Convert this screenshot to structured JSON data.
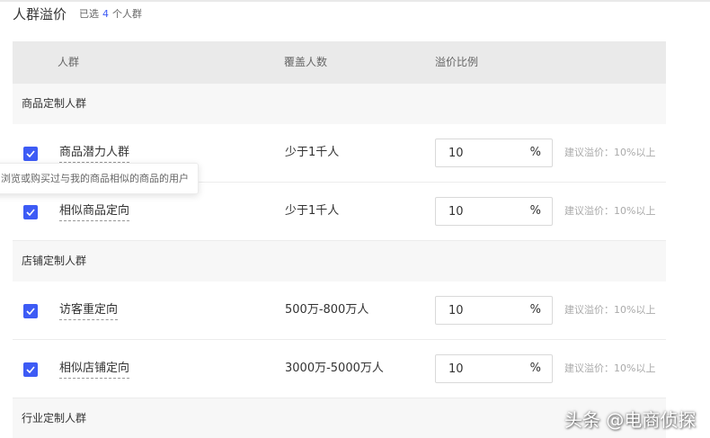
{
  "header": {
    "title": "人群溢价",
    "selected_prefix": "已选",
    "selected_count": "4",
    "selected_suffix": "个人群"
  },
  "table": {
    "columns": [
      "人群",
      "覆盖人数",
      "溢价比例"
    ],
    "groups": [
      {
        "title": "商品定制人群",
        "rows": [
          {
            "name": "商品潜力人群",
            "coverage": "少于1千人",
            "rate": "10",
            "unit": "%",
            "suggestion": "建议溢价：10%以上",
            "checked": true
          },
          {
            "name": "相似商品定向",
            "coverage": "少于1千人",
            "rate": "10",
            "unit": "%",
            "suggestion": "建议溢价：10%以上",
            "checked": true
          }
        ]
      },
      {
        "title": "店铺定制人群",
        "rows": [
          {
            "name": "访客重定向",
            "coverage": "500万-800万人",
            "rate": "10",
            "unit": "%",
            "suggestion": "建议溢价：10%以上",
            "checked": true
          },
          {
            "name": "相似店铺定向",
            "coverage": "3000万-5000万人",
            "rate": "10",
            "unit": "%",
            "suggestion": "建议溢价：10%以上",
            "checked": true
          }
        ]
      },
      {
        "title": "行业定制人群",
        "rows": []
      }
    ]
  },
  "tooltip": {
    "text": "浏览或购买过与我的商品相似的商品的用户"
  },
  "watermark": {
    "text": "头条 @电商侦探"
  },
  "colors": {
    "accent": "#3d5bf5",
    "header_bg": "#eaeaea",
    "group_bg": "#f7f7f7"
  },
  "icons": {
    "checkbox": "checkmark-icon"
  }
}
